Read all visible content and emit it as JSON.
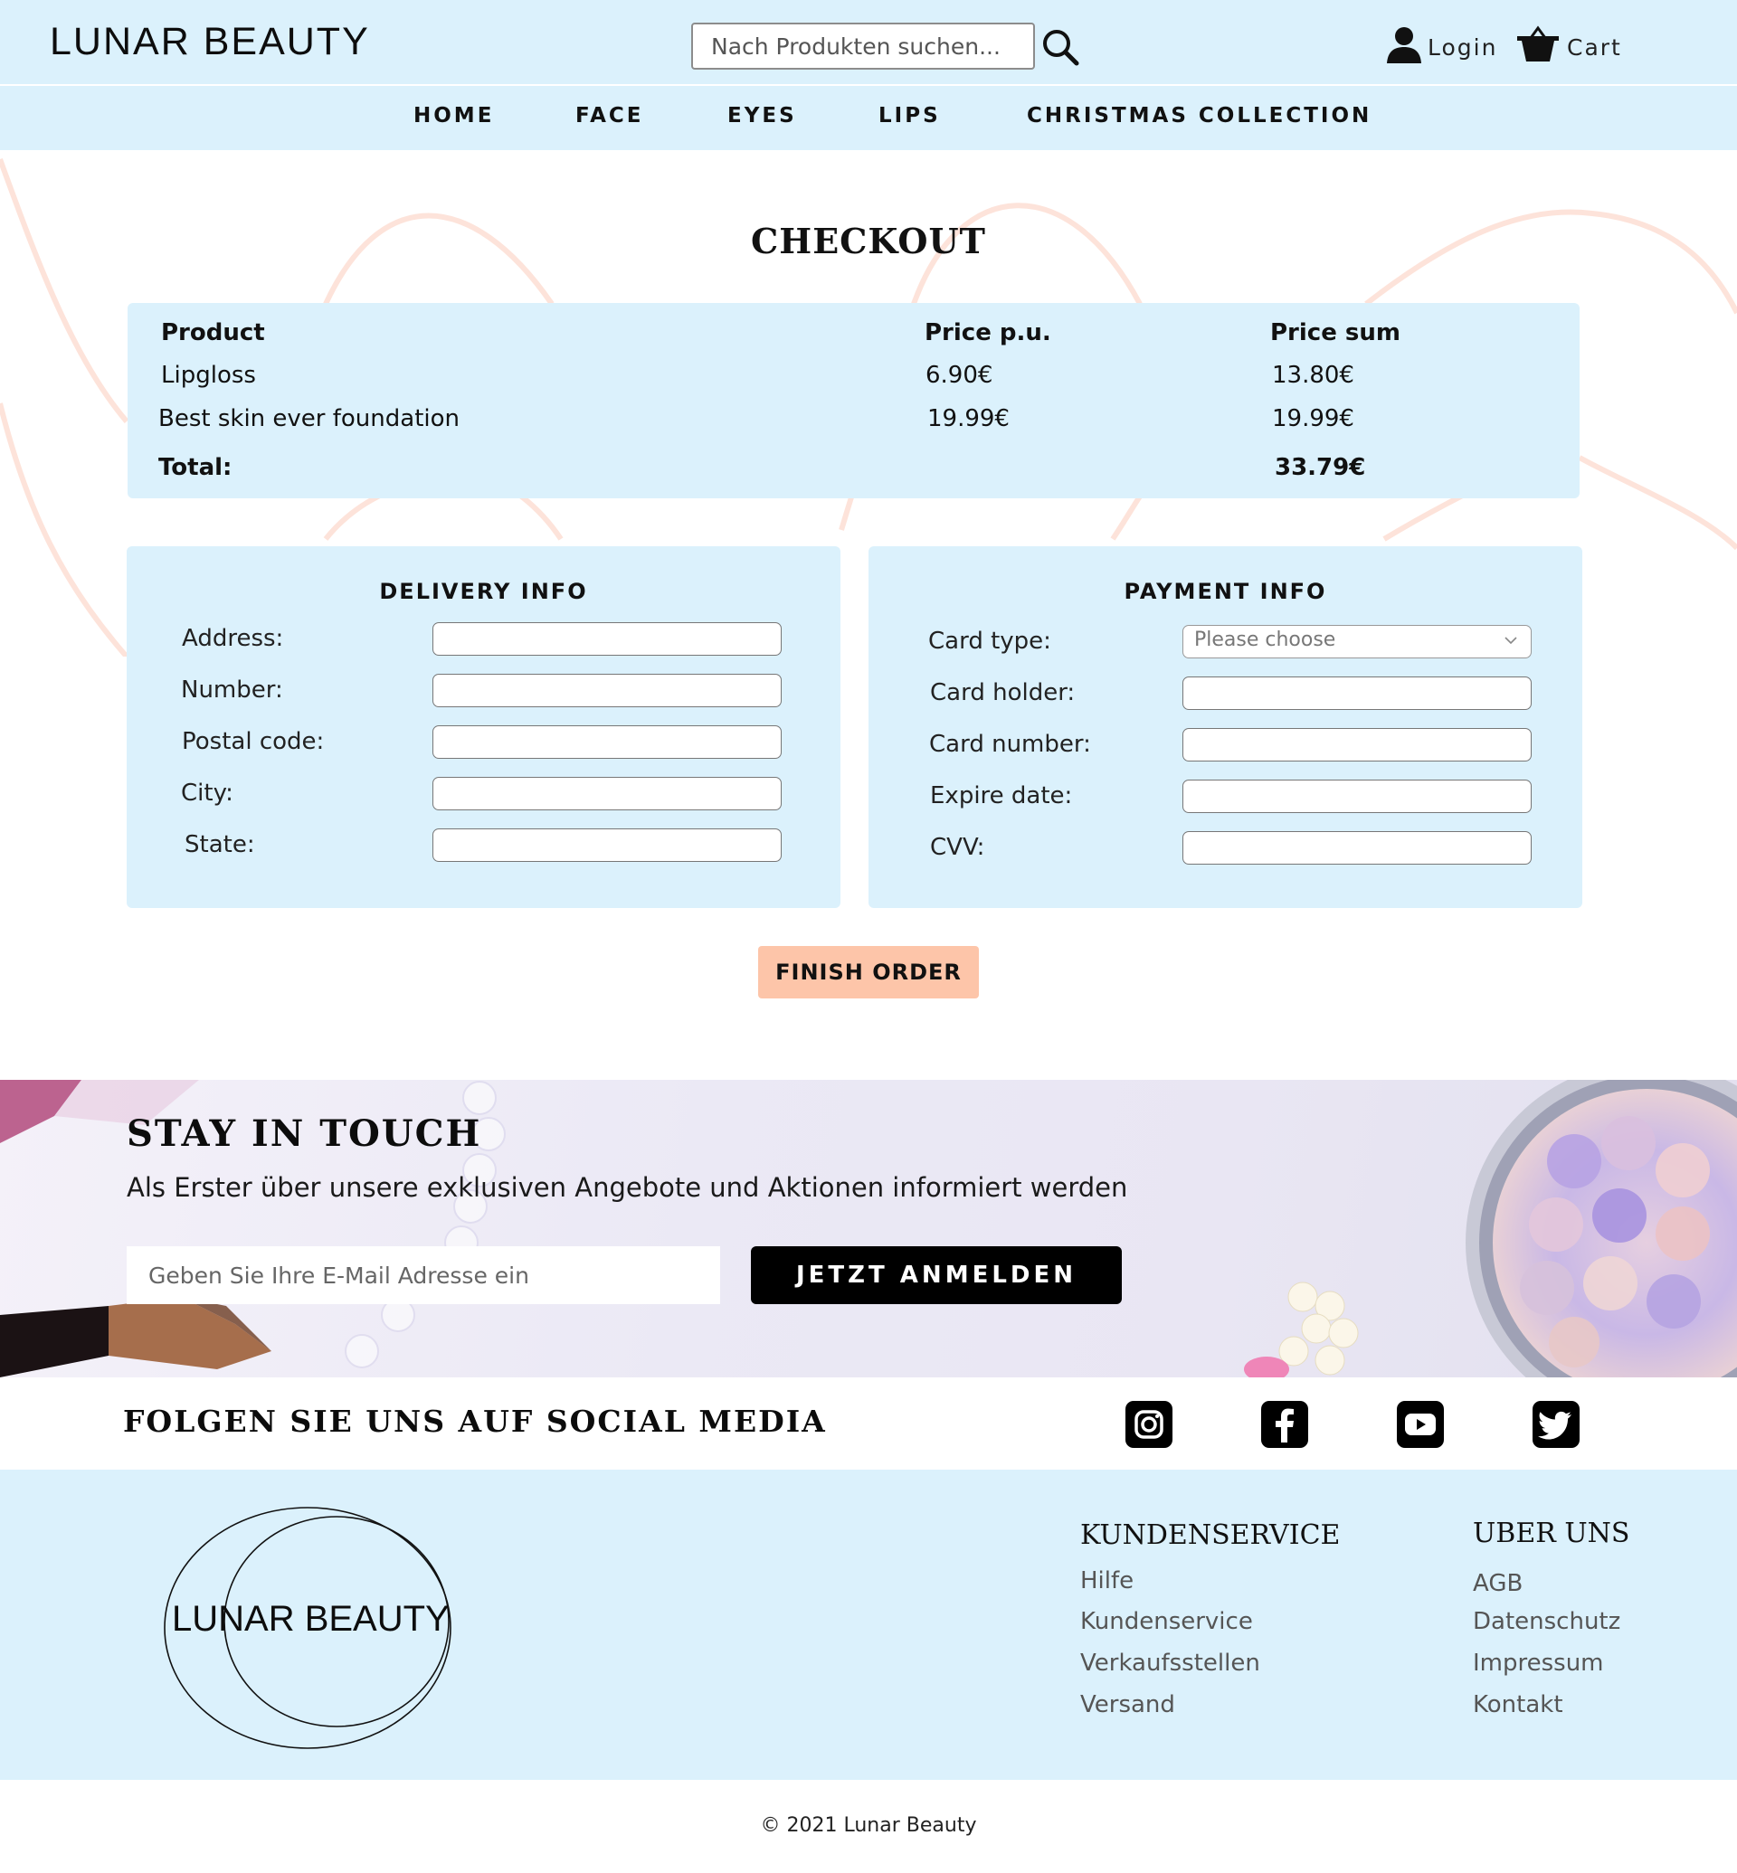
{
  "header": {
    "brand": "LUNAR BEAUTY",
    "search_placeholder": "Nach Produkten suchen...",
    "login_label": "Login",
    "cart_label": "Cart"
  },
  "nav": {
    "items": [
      "HOME",
      "FACE",
      "EYES",
      "LIPS",
      "CHRISTMAS COLLECTION"
    ]
  },
  "page_title": "CHECKOUT",
  "order": {
    "headers": {
      "product": "Product",
      "price_pu": "Price p.u.",
      "price_sum": "Price sum"
    },
    "rows": [
      {
        "product": "Lipgloss",
        "price_pu": "6.90€",
        "price_sum": "13.80€"
      },
      {
        "product": "Best skin ever foundation",
        "price_pu": "19.99€",
        "price_sum": "19.99€"
      }
    ],
    "total_label": "Total:",
    "total_value": "33.79€"
  },
  "delivery": {
    "title": "DELIVERY INFO",
    "fields": [
      "Address:",
      "Number:",
      "Postal code:",
      "City:",
      "State:"
    ]
  },
  "payment": {
    "title": "PAYMENT INFO",
    "card_type_label": "Card type:",
    "card_type_value": "Please choose",
    "fields": [
      "Card holder:",
      "Card number:",
      "Expire date:",
      "CVV:"
    ]
  },
  "finish_button": "FINISH ORDER",
  "newsletter": {
    "title": "STAY IN TOUCH",
    "subtitle": "Als Erster über unsere exklusiven Angebote und Aktionen informiert werden",
    "email_placeholder": "Geben Sie Ihre E-Mail Adresse ein",
    "button": "JETZT ANMELDEN"
  },
  "social": {
    "title": "FOLGEN SIE UNS AUF SOCIAL MEDIA",
    "icons": [
      "instagram-icon",
      "facebook-icon",
      "youtube-icon",
      "twitter-icon"
    ]
  },
  "footer": {
    "logo_text": "LUNAR BEAUTY",
    "kundenservice": {
      "heading": "KUNDENSERVICE",
      "links": [
        "Hilfe",
        "Kundenservice",
        "Verkaufsstellen",
        "Versand"
      ]
    },
    "ueber_uns": {
      "heading": "UBER UNS",
      "links": [
        "AGB",
        "Datenschutz",
        "Impressum",
        "Kontakt"
      ]
    },
    "copyright": "© 2021 Lunar Beauty"
  },
  "colors": {
    "header_bg": "#dbf1fc",
    "accent_button": "#fdc5a9",
    "decor_curve": "#fde3da"
  }
}
